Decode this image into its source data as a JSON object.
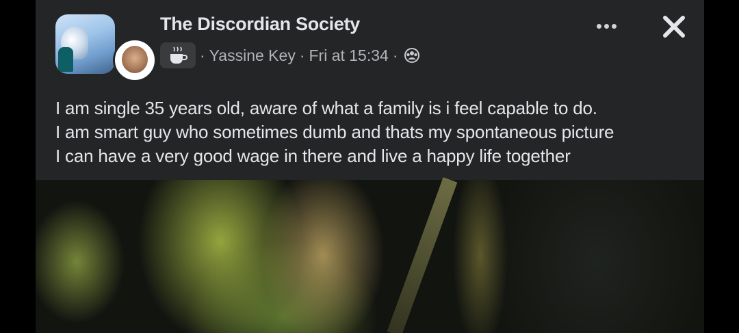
{
  "post": {
    "group_name": "The Discordian Society",
    "author": "Yassine Key",
    "separator": "·",
    "timestamp": "Fri at 15:34",
    "privacy_icon": "group-privacy-icon",
    "badge_icon": "coffee-cup-icon",
    "more_icon": "more-options-icon",
    "close_icon": "close-icon",
    "text_lines": [
      "I am single 35 years old, aware of what a family is i feel capable to do.",
      "I am smart guy who sometimes dumb and thats my spontaneous picture",
      "I can have a very good wage in there and live a happy life together"
    ]
  },
  "colors": {
    "card_background": "#242526",
    "primary_text": "#e4e6eb",
    "secondary_text": "#b0b3b8",
    "page_background": "#000000"
  }
}
